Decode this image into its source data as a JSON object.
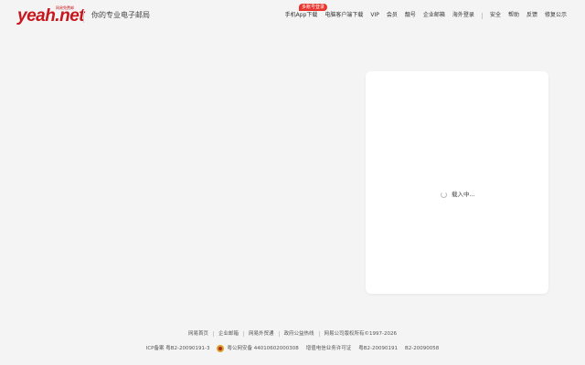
{
  "header": {
    "logo_text": "yeah.net",
    "logo_sub": "网易免费邮",
    "tagline": "你的专业电子邮局",
    "badge": "多账号登录",
    "nav": [
      "手机App下载",
      "电脑客户端下载",
      "VIP",
      "会员",
      "靓号",
      "企业邮箱",
      "海外登录",
      "安全",
      "帮助",
      "反馈",
      "修复公示"
    ]
  },
  "main": {
    "loading_text": "载入中..."
  },
  "footer": {
    "links": [
      "网易首页",
      "企业邮箱",
      "网易外贸通",
      "政府公益热线",
      "网易公司版权所有©1997-2026"
    ],
    "icp": "ICP备案 粤B2-20090191-3",
    "police": "粤公网安备 44010602000308",
    "telecom": "增值电信业务许可证",
    "license1": "粤B2-20090191",
    "license2": "B2-20090058"
  }
}
